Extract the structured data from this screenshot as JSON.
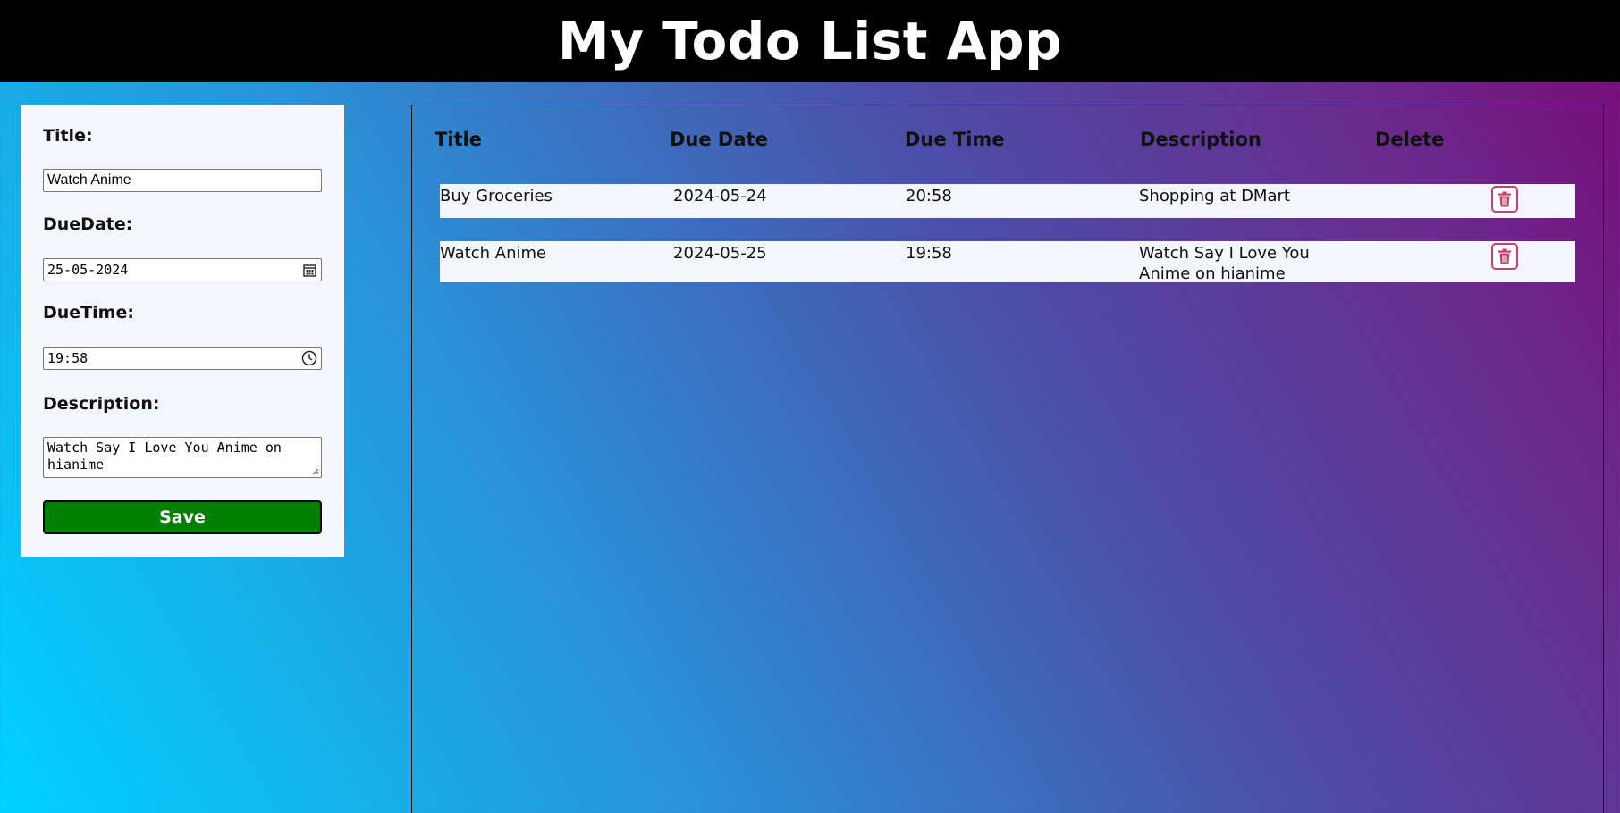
{
  "header": {
    "title": "My Todo List App"
  },
  "form": {
    "title_label": "Title:",
    "title_value": "Watch Anime",
    "duedate_label": "DueDate:",
    "duedate_value": "25-05-2024",
    "duetime_label": "DueTime:",
    "duetime_value": "19:58",
    "description_label": "Description:",
    "description_value": "Watch Say I Love You Anime on hianime",
    "save_label": "Save"
  },
  "table": {
    "headers": [
      "Title",
      "Due Date",
      "Due Time",
      "Description",
      "Delete"
    ],
    "rows": [
      {
        "title": "Buy Groceries",
        "due_date": "2024-05-24",
        "due_time": "20:58",
        "description": "Shopping at DMart"
      },
      {
        "title": "Watch Anime",
        "due_date": "2024-05-25",
        "due_time": "19:58",
        "description": "Watch Say I Love You Anime on hianime"
      }
    ]
  },
  "colors": {
    "header_bg": "#000000",
    "save_button": "#008000",
    "delete_icon": "#c0456e",
    "panel_bg": "#f4f6fb"
  },
  "icons": {
    "date_field": "calendar-icon",
    "time_field": "clock-icon",
    "delete": "trash-icon"
  }
}
